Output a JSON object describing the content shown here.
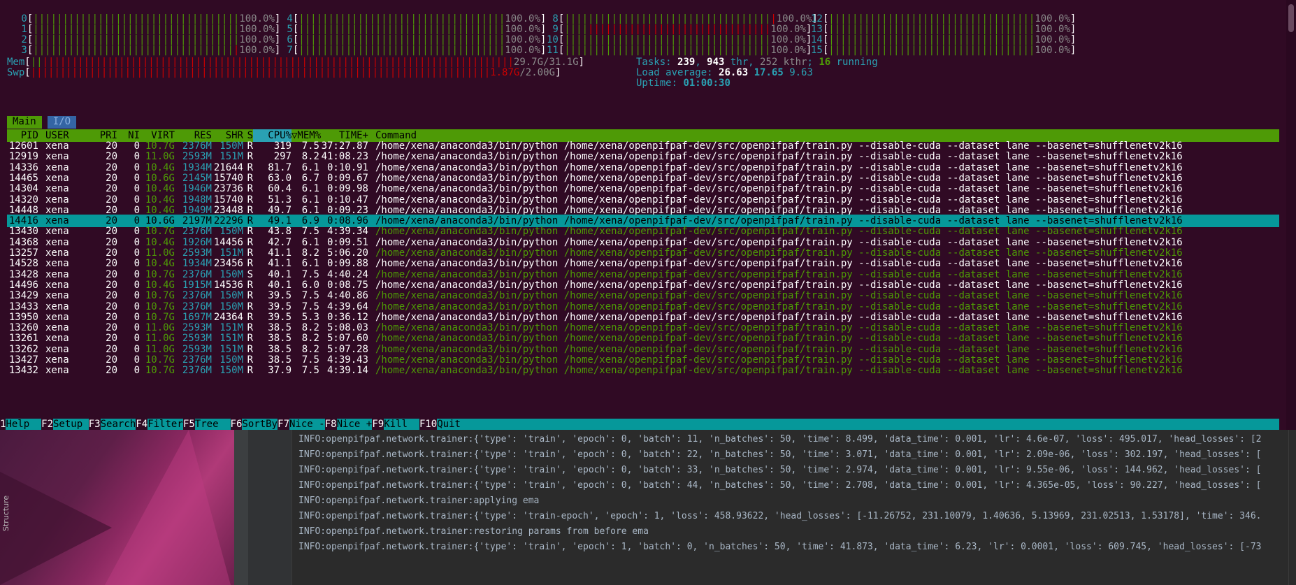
{
  "cpu_meters": [
    {
      "id": "0",
      "pct": "100.0%"
    },
    {
      "id": "1",
      "pct": "100.0%"
    },
    {
      "id": "2",
      "pct": "100.0%"
    },
    {
      "id": "3",
      "pct": "100.0%"
    },
    {
      "id": "4",
      "pct": "100.0%"
    },
    {
      "id": "5",
      "pct": "100.0%"
    },
    {
      "id": "6",
      "pct": "100.0%"
    },
    {
      "id": "7",
      "pct": "100.0%"
    },
    {
      "id": "8",
      "pct": "100.0%"
    },
    {
      "id": "9",
      "pct": "100.0%"
    },
    {
      "id": "10",
      "pct": "100.0%"
    },
    {
      "id": "11",
      "pct": "100.0%"
    },
    {
      "id": "12",
      "pct": "100.0%"
    },
    {
      "id": "13",
      "pct": "100.0%"
    },
    {
      "id": "14",
      "pct": "100.0%"
    },
    {
      "id": "15",
      "pct": "100.0%"
    }
  ],
  "mem": {
    "label": "Mem",
    "used": "29.7G",
    "total": "31.1G"
  },
  "swp": {
    "label": "Swp",
    "used": "1.87G",
    "total": "2.00G"
  },
  "tasks": {
    "label": "Tasks: ",
    "count": "239",
    "thr": "943",
    "thr_label": " thr, ",
    "kthr": "252 kthr",
    "running": "16",
    "running_label": " running"
  },
  "load": {
    "label": "Load average: ",
    "l1": "26.63",
    "l5": "17.65",
    "l15": "9.63"
  },
  "uptime": {
    "label": "Uptime: ",
    "value": "01:00:30"
  },
  "tabs": [
    {
      "label": "Main"
    },
    {
      "label": "I/O"
    }
  ],
  "columns": [
    "PID",
    "USER",
    "PRI",
    "NI",
    "VIRT",
    "RES",
    "SHR",
    "S",
    "CPU%",
    "▽MEM%",
    "TIME+",
    "Command"
  ],
  "processes": [
    [
      "12601",
      "xena",
      "20",
      "0",
      "10.7G",
      "2376M",
      "150M",
      "R",
      "319",
      "7.5",
      "37:27.87",
      "/home/xena/anaconda3/bin/python /home/xena/openpifpaf-dev/src/openpifpaf/train.py --disable-cuda --dataset lane --basenet=shufflenetv2k16"
    ],
    [
      "12919",
      "xena",
      "20",
      "0",
      "11.0G",
      "2593M",
      "151M",
      "R",
      "297",
      "8.2",
      "41:08.23",
      "/home/xena/anaconda3/bin/python /home/xena/openpifpaf-dev/src/openpifpaf/train.py --disable-cuda --dataset lane --basenet=shufflenetv2k16"
    ],
    [
      "14336",
      "xena",
      "20",
      "0",
      "10.4G",
      "1934M",
      "21644",
      "R",
      "81.7",
      "6.1",
      "0:10.91",
      "/home/xena/anaconda3/bin/python /home/xena/openpifpaf-dev/src/openpifpaf/train.py --disable-cuda --dataset lane --basenet=shufflenetv2k16"
    ],
    [
      "14465",
      "xena",
      "20",
      "0",
      "10.6G",
      "2145M",
      "15740",
      "R",
      "63.0",
      "6.7",
      "0:09.67",
      "/home/xena/anaconda3/bin/python /home/xena/openpifpaf-dev/src/openpifpaf/train.py --disable-cuda --dataset lane --basenet=shufflenetv2k16"
    ],
    [
      "14304",
      "xena",
      "20",
      "0",
      "10.4G",
      "1946M",
      "23736",
      "R",
      "60.4",
      "6.1",
      "0:09.98",
      "/home/xena/anaconda3/bin/python /home/xena/openpifpaf-dev/src/openpifpaf/train.py --disable-cuda --dataset lane --basenet=shufflenetv2k16"
    ],
    [
      "14320",
      "xena",
      "20",
      "0",
      "10.4G",
      "1948M",
      "15740",
      "R",
      "51.3",
      "6.1",
      "0:10.47",
      "/home/xena/anaconda3/bin/python /home/xena/openpifpaf-dev/src/openpifpaf/train.py --disable-cuda --dataset lane --basenet=shufflenetv2k16"
    ],
    [
      "14448",
      "xena",
      "20",
      "0",
      "10.4G",
      "1949M",
      "23448",
      "R",
      "49.7",
      "6.1",
      "0:09.23",
      "/home/xena/anaconda3/bin/python /home/xena/openpifpaf-dev/src/openpifpaf/train.py --disable-cuda --dataset lane --basenet=shufflenetv2k16"
    ],
    [
      "14416",
      "xena",
      "20",
      "0",
      "10.6G",
      "2197M",
      "22296",
      "R",
      "49.1",
      "6.9",
      "0:08.96",
      "/home/xena/anaconda3/bin/python /home/xena/openpifpaf-dev/src/openpifpaf/train.py --disable-cuda --dataset lane --basenet=shufflenetv2k16"
    ],
    [
      "13430",
      "xena",
      "20",
      "0",
      "10.7G",
      "2376M",
      "150M",
      "R",
      "43.8",
      "7.5",
      "4:39.34",
      "/home/xena/anaconda3/bin/python /home/xena/openpifpaf-dev/src/openpifpaf/train.py --disable-cuda --dataset lane --basenet=shufflenetv2k16"
    ],
    [
      "14368",
      "xena",
      "20",
      "0",
      "10.4G",
      "1926M",
      "14456",
      "R",
      "42.7",
      "6.1",
      "0:09.51",
      "/home/xena/anaconda3/bin/python /home/xena/openpifpaf-dev/src/openpifpaf/train.py --disable-cuda --dataset lane --basenet=shufflenetv2k16"
    ],
    [
      "13257",
      "xena",
      "20",
      "0",
      "11.0G",
      "2593M",
      "151M",
      "R",
      "41.1",
      "8.2",
      "5:06.20",
      "/home/xena/anaconda3/bin/python /home/xena/openpifpaf-dev/src/openpifpaf/train.py --disable-cuda --dataset lane --basenet=shufflenetv2k16"
    ],
    [
      "14528",
      "xena",
      "20",
      "0",
      "10.4G",
      "1934M",
      "23456",
      "R",
      "41.1",
      "6.1",
      "0:09.88",
      "/home/xena/anaconda3/bin/python /home/xena/openpifpaf-dev/src/openpifpaf/train.py --disable-cuda --dataset lane --basenet=shufflenetv2k16"
    ],
    [
      "13428",
      "xena",
      "20",
      "0",
      "10.7G",
      "2376M",
      "150M",
      "S",
      "40.1",
      "7.5",
      "4:40.24",
      "/home/xena/anaconda3/bin/python /home/xena/openpifpaf-dev/src/openpifpaf/train.py --disable-cuda --dataset lane --basenet=shufflenetv2k16"
    ],
    [
      "14496",
      "xena",
      "20",
      "0",
      "10.4G",
      "1915M",
      "14536",
      "R",
      "40.1",
      "6.0",
      "0:08.75",
      "/home/xena/anaconda3/bin/python /home/xena/openpifpaf-dev/src/openpifpaf/train.py --disable-cuda --dataset lane --basenet=shufflenetv2k16"
    ],
    [
      "13429",
      "xena",
      "20",
      "0",
      "10.7G",
      "2376M",
      "150M",
      "R",
      "39.5",
      "7.5",
      "4:40.86",
      "/home/xena/anaconda3/bin/python /home/xena/openpifpaf-dev/src/openpifpaf/train.py --disable-cuda --dataset lane --basenet=shufflenetv2k16"
    ],
    [
      "13433",
      "xena",
      "20",
      "0",
      "10.7G",
      "2376M",
      "150M",
      "R",
      "39.5",
      "7.5",
      "4:39.64",
      "/home/xena/anaconda3/bin/python /home/xena/openpifpaf-dev/src/openpifpaf/train.py --disable-cuda --dataset lane --basenet=shufflenetv2k16"
    ],
    [
      "13950",
      "xena",
      "20",
      "0",
      "10.7G",
      "1697M",
      "24364",
      "R",
      "39.5",
      "5.3",
      "0:36.12",
      "/home/xena/anaconda3/bin/python /home/xena/openpifpaf-dev/src/openpifpaf/train.py --disable-cuda --dataset lane --basenet=shufflenetv2k16"
    ],
    [
      "13260",
      "xena",
      "20",
      "0",
      "11.0G",
      "2593M",
      "151M",
      "R",
      "38.5",
      "8.2",
      "5:08.03",
      "/home/xena/anaconda3/bin/python /home/xena/openpifpaf-dev/src/openpifpaf/train.py --disable-cuda --dataset lane --basenet=shufflenetv2k16"
    ],
    [
      "13261",
      "xena",
      "20",
      "0",
      "11.0G",
      "2593M",
      "151M",
      "R",
      "38.5",
      "8.2",
      "5:07.60",
      "/home/xena/anaconda3/bin/python /home/xena/openpifpaf-dev/src/openpifpaf/train.py --disable-cuda --dataset lane --basenet=shufflenetv2k16"
    ],
    [
      "13262",
      "xena",
      "20",
      "0",
      "11.0G",
      "2593M",
      "151M",
      "R",
      "38.5",
      "8.2",
      "5:07.28",
      "/home/xena/anaconda3/bin/python /home/xena/openpifpaf-dev/src/openpifpaf/train.py --disable-cuda --dataset lane --basenet=shufflenetv2k16"
    ],
    [
      "13427",
      "xena",
      "20",
      "0",
      "10.7G",
      "2376M",
      "150M",
      "R",
      "38.5",
      "7.5",
      "4:39.43",
      "/home/xena/anaconda3/bin/python /home/xena/openpifpaf-dev/src/openpifpaf/train.py --disable-cuda --dataset lane --basenet=shufflenetv2k16"
    ],
    [
      "13432",
      "xena",
      "20",
      "0",
      "10.7G",
      "2376M",
      "150M",
      "R",
      "37.9",
      "7.5",
      "4:39.14",
      "/home/xena/anaconda3/bin/python /home/xena/openpifpaf-dev/src/openpifpaf/train.py --disable-cuda --dataset lane --basenet=shufflenetv2k16"
    ]
  ],
  "fkeys": [
    {
      "key": "1",
      "label": "Help  "
    },
    {
      "key": "F2",
      "label": "Setup "
    },
    {
      "key": "F3",
      "label": "Search"
    },
    {
      "key": "F4",
      "label": "Filter"
    },
    {
      "key": "F5",
      "label": "Tree  "
    },
    {
      "key": "F6",
      "label": "SortBy"
    },
    {
      "key": "F7",
      "label": "Nice -"
    },
    {
      "key": "F8",
      "label": "Nice +"
    },
    {
      "key": "F9",
      "label": "Kill  "
    },
    {
      "key": "F10",
      "label": "Quit"
    }
  ],
  "ide": {
    "structure_tab": "Structure"
  },
  "log_lines": [
    "INFO:openpifpaf.network.trainer:{'type': 'train', 'epoch': 0, 'batch': 11, 'n_batches': 50, 'time': 8.499, 'data_time': 0.001, 'lr': 4.6e-07, 'loss': 495.017, 'head_losses': [2",
    "INFO:openpifpaf.network.trainer:{'type': 'train', 'epoch': 0, 'batch': 22, 'n_batches': 50, 'time': 3.071, 'data_time': 0.001, 'lr': 2.09e-06, 'loss': 302.197, 'head_losses': [",
    "INFO:openpifpaf.network.trainer:{'type': 'train', 'epoch': 0, 'batch': 33, 'n_batches': 50, 'time': 2.974, 'data_time': 0.001, 'lr': 9.55e-06, 'loss': 144.962, 'head_losses': [",
    "INFO:openpifpaf.network.trainer:{'type': 'train', 'epoch': 0, 'batch': 44, 'n_batches': 50, 'time': 2.708, 'data_time': 0.001, 'lr': 4.365e-05, 'loss': 90.227, 'head_losses': [",
    "INFO:openpifpaf.network.trainer:applying ema",
    "INFO:openpifpaf.network.trainer:{'type': 'train-epoch', 'epoch': 1, 'loss': 458.93622, 'head_losses': [-11.26752, 231.10079, 1.40636, 5.13969, 231.02513, 1.53178], 'time': 346.",
    "INFO:openpifpaf.network.trainer:restoring params from before ema",
    "INFO:openpifpaf.network.trainer:{'type': 'train', 'epoch': 1, 'batch': 0, 'n_batches': 50, 'time': 41.873, 'data_time': 6.23, 'lr': 0.0001, 'loss': 609.745, 'head_losses': [-73"
  ]
}
